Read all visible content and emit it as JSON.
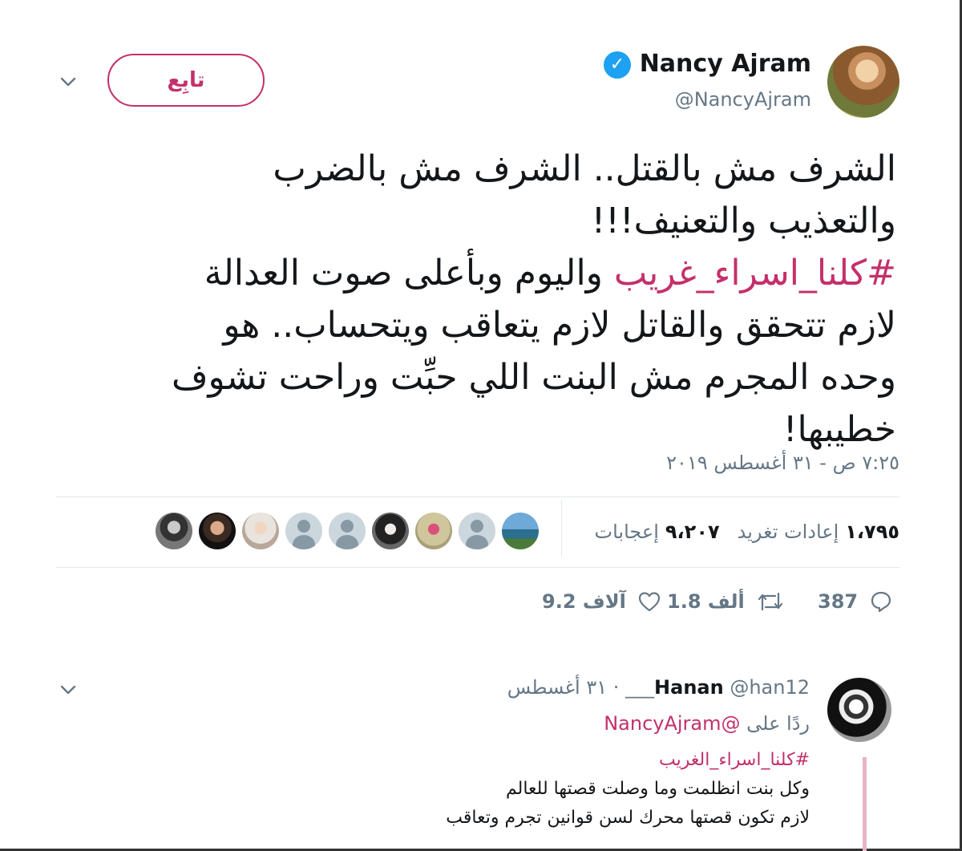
{
  "tweet": {
    "author": {
      "display_name": "Nancy Ajram",
      "handle": "@NancyAjram",
      "verified": true
    },
    "follow_label": "تابِع",
    "text_lines": [
      "الشرف مش بالقتل.. الشرف مش بالضرب",
      "والتعذيب والتعنيف!!!"
    ],
    "hashtag": "#كلنا_اسراء_غريب",
    "hashtag_suffix": " واليوم وبأعلى صوت العدالة",
    "text_lines_after": [
      "لازم تتحقق والقاتل لازم يتعاقب ويتحساب.. هو",
      "وحده المجرم مش البنت اللي حبِّت وراحت تشوف",
      "خطيبها!"
    ],
    "timestamp": "٧:٢٥ ص - ٣١ أغسطس ٢٠١٩",
    "stats": {
      "retweets_count": "١،٧٩٥",
      "retweets_label": "إعادات تغريد",
      "likes_count": "٩،٢٠٧",
      "likes_label": "إعجابات"
    },
    "liker_avatars": [
      "profile-photo-1",
      "profile-photo-2",
      "profile-photo-3",
      "default-avatar",
      "default-avatar",
      "profile-photo-4",
      "profile-photo-5",
      "default-avatar",
      "profile-photo-6"
    ],
    "actions": {
      "replies": "387",
      "retweets": "1.8 ألف",
      "likes": "9.2 آلاف"
    }
  },
  "reply": {
    "display_name": "Hanan",
    "handle": "@han12___",
    "date": "٣١ أغسطس",
    "separator": "·",
    "replying_to_prefix": "ردًا على",
    "replying_to_handle": "@NancyAjram",
    "hashtag": "#كلنا_اسراء_الغريب",
    "lines": [
      "وكل بنت انظلمت وما وصلت قصتها للعالم",
      "لازم تكون قصتها محرك لسن قوانين تجرم وتعاقب"
    ]
  },
  "colors": {
    "accent": "#c4306b",
    "verified": "#1da1f2",
    "muted": "#657786",
    "divider": "#e1e8ed"
  }
}
